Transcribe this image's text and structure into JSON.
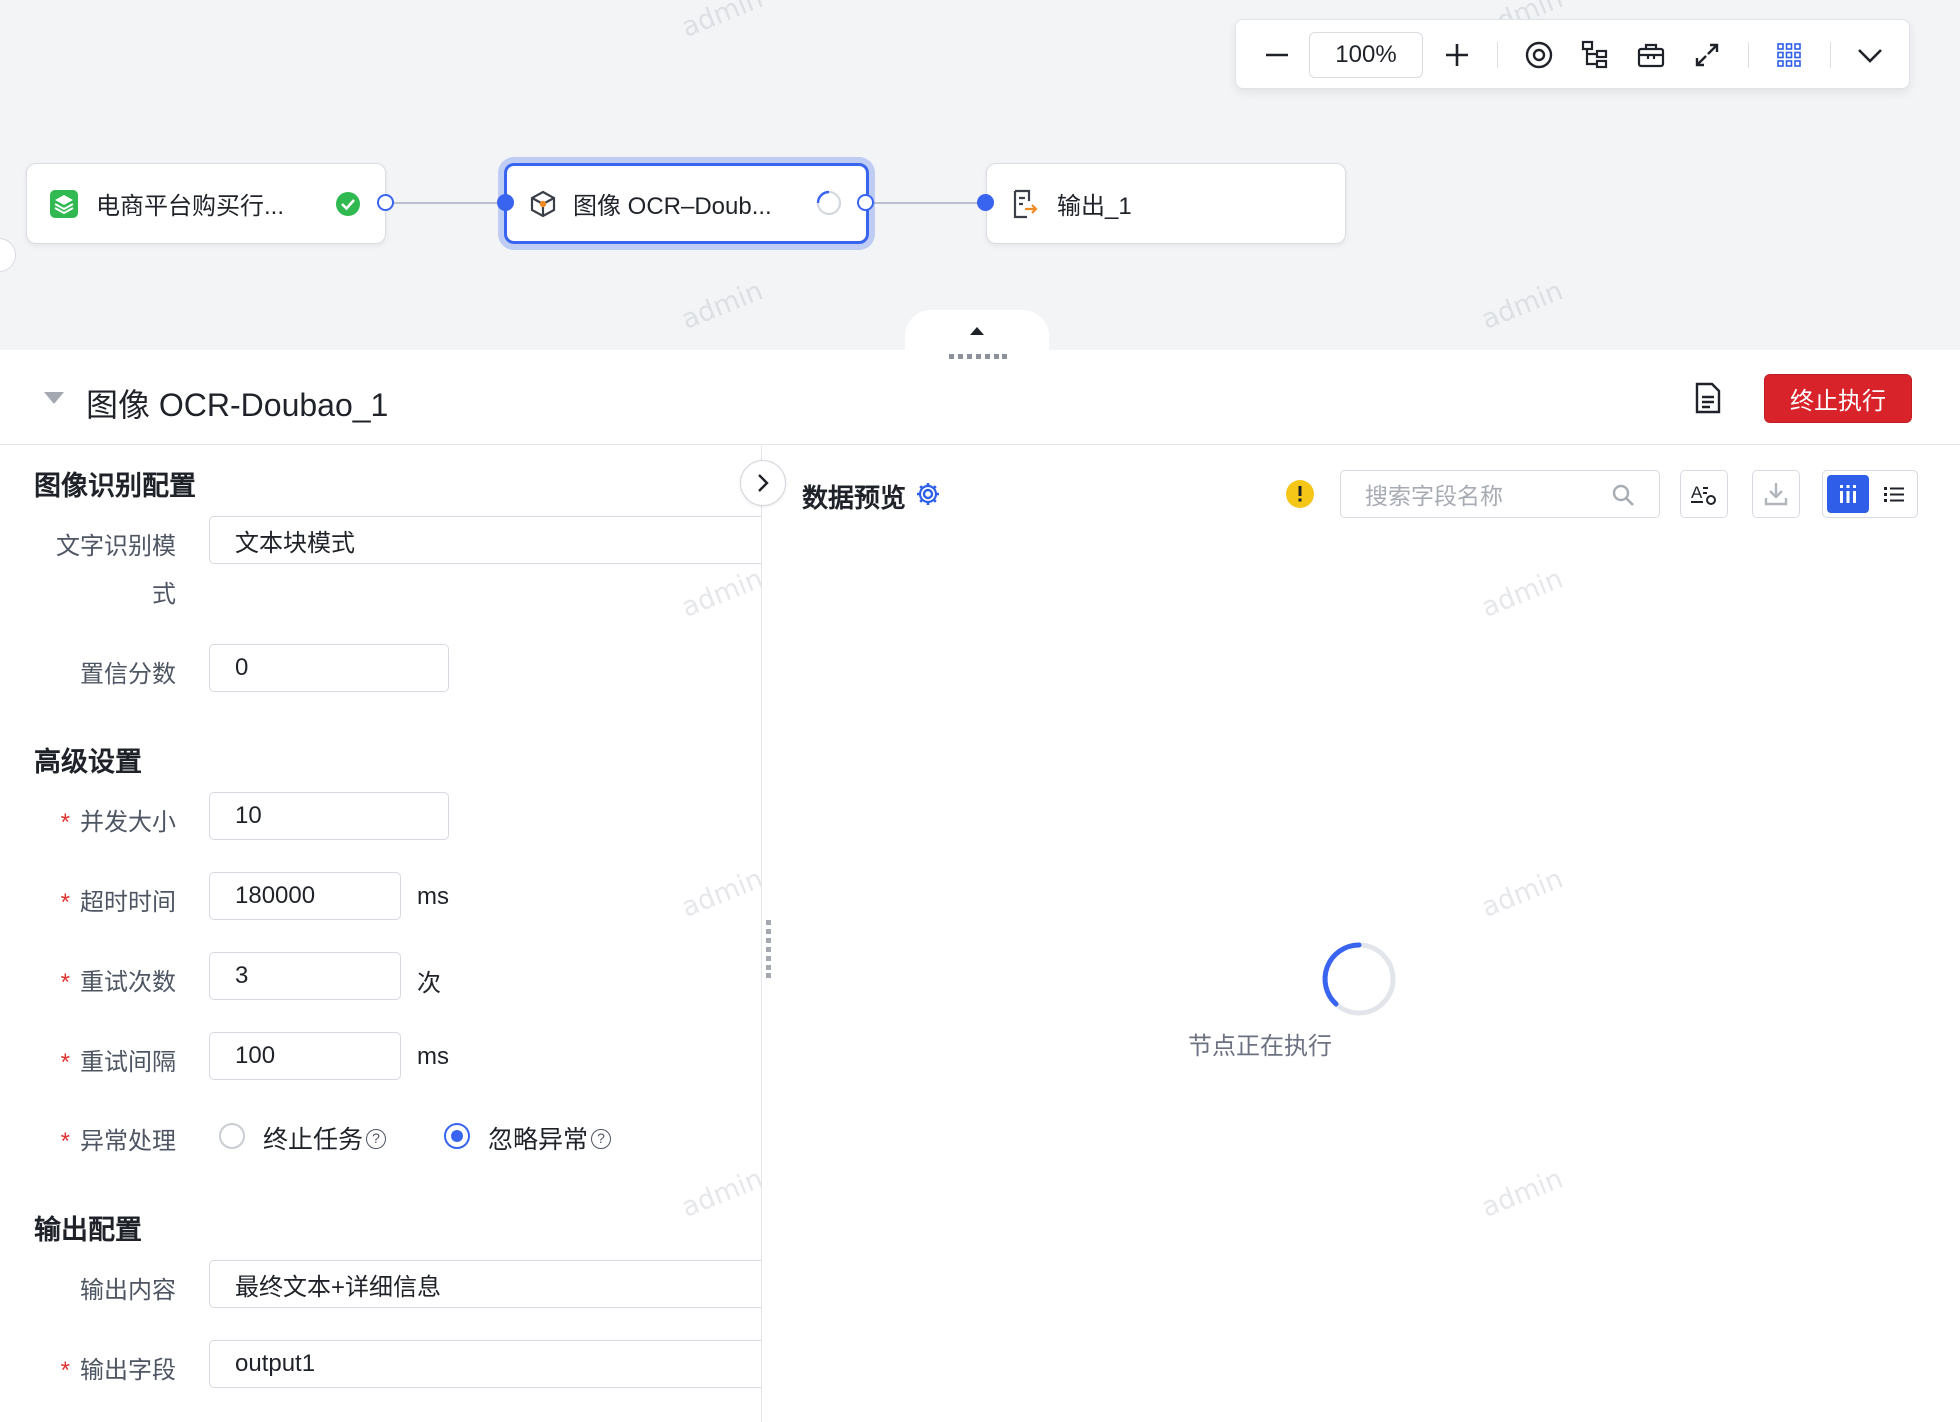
{
  "watermark": "admin",
  "toolbar": {
    "zoom": "100%"
  },
  "nodes": [
    {
      "title": "电商平台购买行...",
      "status": "success"
    },
    {
      "title": "图像 OCR–Doub...",
      "status": "running"
    },
    {
      "title": "输出_1",
      "status": "idle"
    }
  ],
  "panel": {
    "title": "图像 OCR-Doubao_1",
    "stop_label": "终止执行"
  },
  "config": {
    "section_recognition": "图像识别配置",
    "text_mode_label_1": "文字识别模",
    "text_mode_label_2": "式",
    "text_mode_value": "文本块模式",
    "confidence_label": "置信分数",
    "confidence_value": "0",
    "section_advanced": "高级设置",
    "concurrency_label": "并发大小",
    "concurrency_value": "10",
    "timeout_label": "超时时间",
    "timeout_value": "180000",
    "timeout_unit": "ms",
    "retry_label": "重试次数",
    "retry_value": "3",
    "retry_unit": "次",
    "retry_interval_label": "重试间隔",
    "retry_interval_value": "100",
    "retry_interval_unit": "ms",
    "exception_label": "异常处理",
    "exception_options": [
      "终止任务",
      "忽略异常"
    ],
    "exception_selected": "忽略异常",
    "section_output": "输出配置",
    "output_content_label": "输出内容",
    "output_content_value": "最终文本+详细信息",
    "output_field_label": "输出字段",
    "output_field_value": "output1"
  },
  "preview": {
    "title": "数据预览",
    "search_placeholder": "搜索字段名称",
    "loading_text": "节点正在执行"
  },
  "colors": {
    "primary": "#3964f0",
    "danger": "#d9232a",
    "success": "#2fb950",
    "warning": "#f5c518"
  }
}
